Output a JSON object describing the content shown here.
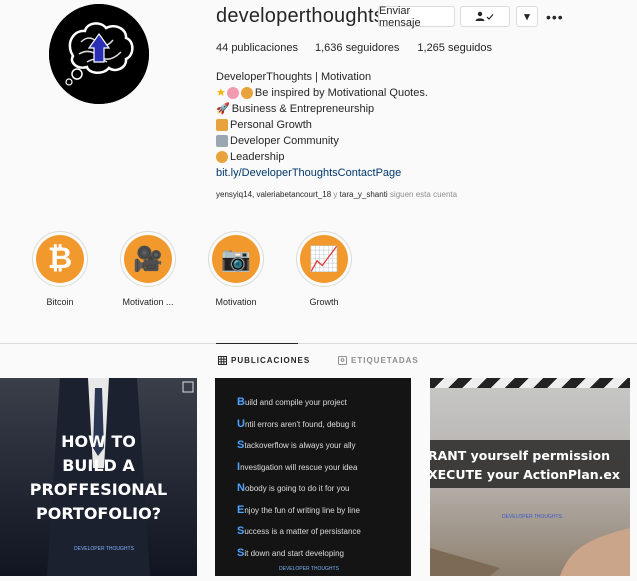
{
  "profile": {
    "username": "developerthoughts",
    "message_button": "Enviar mensaje",
    "follow_button": "👤✓",
    "dropdown_button": "▾",
    "more": "•••",
    "stats": {
      "posts_count": "44",
      "posts_label": "publicaciones",
      "followers_count": "1,636",
      "followers_label": "seguidores",
      "following_count": "1,265",
      "following_label": "seguidos"
    },
    "bio": {
      "name": "DeveloperThoughts | Motivation",
      "line1": "Be inspired by Motivational Quotes.",
      "line2": "Business & Entrepreneurship",
      "line3": "Personal Growth",
      "line4": "Developer Community",
      "line5": "Leadership",
      "link": "bit.ly/DeveloperThoughtsContactPage"
    },
    "followed_by": {
      "users": "yensyiq14, valeriabetancourt_18",
      "and": "y",
      "user3": "tara_y_shanti",
      "suffix": "siguen esta cuenta"
    }
  },
  "highlights": [
    {
      "label": "Bitcoin",
      "glyph": "₿"
    },
    {
      "label": "Motivation ...",
      "glyph": "🎥"
    },
    {
      "label": "Motivation",
      "glyph": "📷"
    },
    {
      "label": "Growth",
      "glyph": "📈"
    }
  ],
  "tabs": {
    "posts": "PUBLICACIONES",
    "tagged": "ETIQUETADAS"
  },
  "posts": {
    "p1": {
      "lines": [
        "HOW TO",
        "BUILD A",
        "PROFFESIONAL",
        "PORTOFOLIO?"
      ],
      "watermark": "DEVELOPER THOUGHTS"
    },
    "p2": {
      "lines": [
        {
          "l": "B",
          "t": "uild and compile your project"
        },
        {
          "l": "U",
          "t": "ntil errors aren't found, debug it"
        },
        {
          "l": "S",
          "t": "tackoverflow is always your ally"
        },
        {
          "l": "I",
          "t": "nvestigation will rescue your idea"
        },
        {
          "l": "N",
          "t": "obody is going to do it for you"
        },
        {
          "l": "E",
          "t": "njoy the fun of writing line by line"
        },
        {
          "l": "S",
          "t": "uccess is a matter of persistance"
        },
        {
          "l": "S",
          "t": "it down and start developing"
        }
      ],
      "watermark": "DEVELOPER THOUGHTS"
    },
    "p3": {
      "line1": "RANT yourself permission",
      "line2": "XECUTE your ActionPlan.ex",
      "watermark": "DEVELOPER THOUGHTS"
    }
  },
  "colors": {
    "accent_orange": "#f2992e",
    "link_blue": "#00376b"
  },
  "icons": [
    "brain-logo",
    "person-check-icon",
    "more-icon",
    "grid-icon",
    "tag-icon"
  ]
}
